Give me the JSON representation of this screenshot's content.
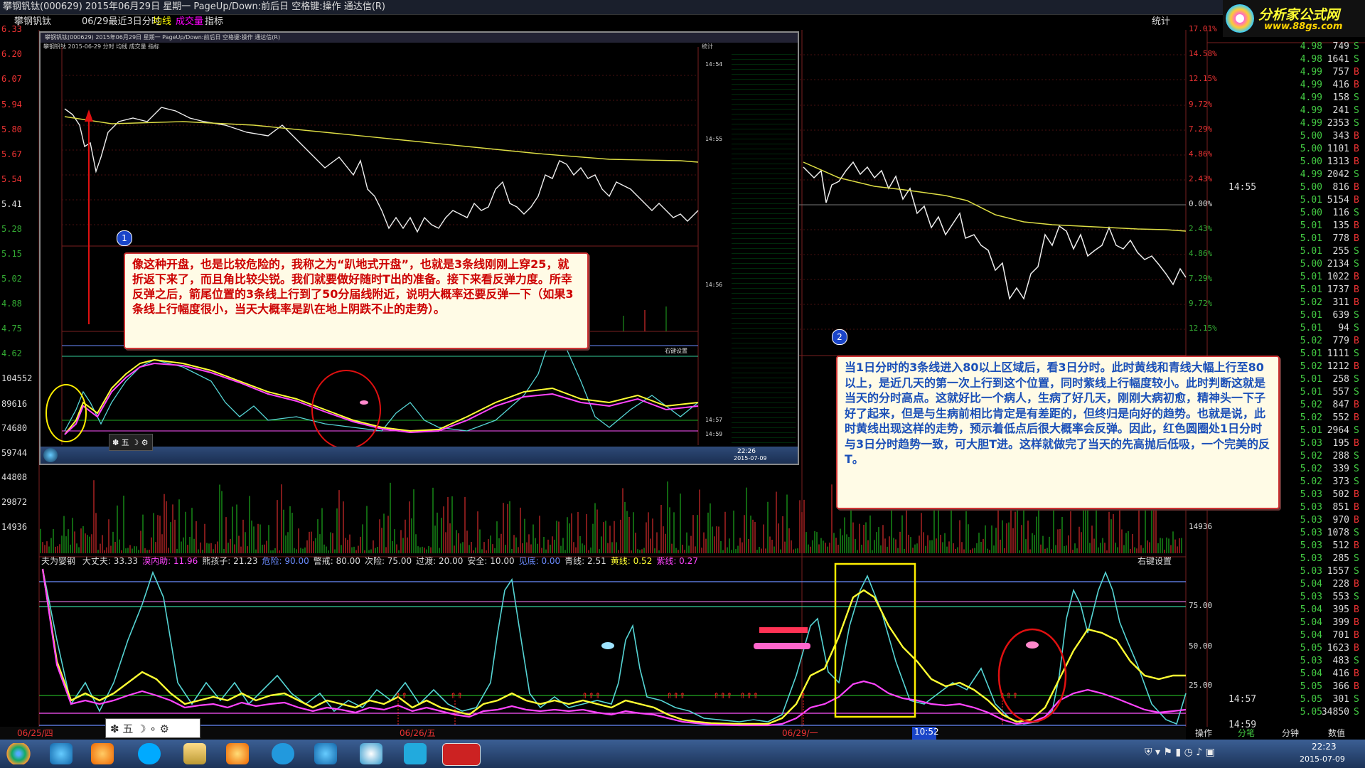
{
  "window": {
    "title": "攀钢钒钛(000629) 2015年06月29日 星期一 PageUp/Down:前后日 空格键:操作 通达信(R)"
  },
  "menubar": {
    "stock_name": "攀钢钒钛",
    "range_label": "06/29最近3日分时",
    "avg_line_label": "均线",
    "volume_label": "成交量",
    "indicator_label": "指标",
    "stats_label": "统计"
  },
  "branding": {
    "logo_text": "分析家公式网",
    "logo_url": "www.88gs.com"
  },
  "left_axis": {
    "price_ticks": [
      "6.33",
      "6.20",
      "6.07",
      "5.94",
      "5.80",
      "5.67",
      "5.54",
      "5.41",
      "5.28",
      "5.15",
      "5.02",
      "4.88",
      "4.75",
      "4.62"
    ],
    "volume_ticks": [
      "104552",
      "89616",
      "74680",
      "59744",
      "44808",
      "29872",
      "14936"
    ]
  },
  "right_axis": {
    "pct_ticks": [
      "17.01%",
      "14.58%",
      "12.15%",
      "9.72%",
      "7.29%",
      "4.86%",
      "2.43%",
      "0.00%",
      "2.43%",
      "4.86%",
      "7.29%",
      "9.72%",
      "12.15%"
    ],
    "volume_tick": "14936",
    "indicator_ticks": [
      "75.00",
      "50.00",
      "25.00"
    ]
  },
  "quote_panel": {
    "time_markers": [
      {
        "label": "14:55",
        "row": 11
      },
      {
        "label": "14:57",
        "row": 51
      },
      {
        "label": "14:59",
        "row": 53
      }
    ],
    "rows": [
      {
        "price": "4.98",
        "vol": "749",
        "bs": "S"
      },
      {
        "price": "4.98",
        "vol": "1641",
        "bs": "S"
      },
      {
        "price": "4.99",
        "vol": "757",
        "bs": "B"
      },
      {
        "price": "4.99",
        "vol": "416",
        "bs": "B"
      },
      {
        "price": "4.99",
        "vol": "158",
        "bs": "S"
      },
      {
        "price": "4.99",
        "vol": "241",
        "bs": "S"
      },
      {
        "price": "4.99",
        "vol": "2353",
        "bs": "S"
      },
      {
        "price": "5.00",
        "vol": "343",
        "bs": "B"
      },
      {
        "price": "5.00",
        "vol": "1101",
        "bs": "B"
      },
      {
        "price": "5.00",
        "vol": "1313",
        "bs": "B"
      },
      {
        "price": "4.99",
        "vol": "2042",
        "bs": "S"
      },
      {
        "price": "5.00",
        "vol": "816",
        "bs": "B"
      },
      {
        "price": "5.01",
        "vol": "5154",
        "bs": "B"
      },
      {
        "price": "5.00",
        "vol": "116",
        "bs": "S"
      },
      {
        "price": "5.01",
        "vol": "135",
        "bs": "B"
      },
      {
        "price": "5.01",
        "vol": "778",
        "bs": "B"
      },
      {
        "price": "5.01",
        "vol": "255",
        "bs": "S"
      },
      {
        "price": "5.00",
        "vol": "2134",
        "bs": "S"
      },
      {
        "price": "5.01",
        "vol": "1022",
        "bs": "B"
      },
      {
        "price": "5.01",
        "vol": "1737",
        "bs": "B"
      },
      {
        "price": "5.02",
        "vol": "311",
        "bs": "B"
      },
      {
        "price": "5.01",
        "vol": "639",
        "bs": "S"
      },
      {
        "price": "5.01",
        "vol": "94",
        "bs": "S"
      },
      {
        "price": "5.02",
        "vol": "779",
        "bs": "B"
      },
      {
        "price": "5.01",
        "vol": "1111",
        "bs": "S"
      },
      {
        "price": "5.02",
        "vol": "1212",
        "bs": "B"
      },
      {
        "price": "5.01",
        "vol": "258",
        "bs": "S"
      },
      {
        "price": "5.01",
        "vol": "557",
        "bs": "S"
      },
      {
        "price": "5.02",
        "vol": "847",
        "bs": "B"
      },
      {
        "price": "5.02",
        "vol": "552",
        "bs": "B"
      },
      {
        "price": "5.01",
        "vol": "2964",
        "bs": "S"
      },
      {
        "price": "5.03",
        "vol": "195",
        "bs": "B"
      },
      {
        "price": "5.02",
        "vol": "288",
        "bs": "S"
      },
      {
        "price": "5.02",
        "vol": "339",
        "bs": "S"
      },
      {
        "price": "5.02",
        "vol": "373",
        "bs": "S"
      },
      {
        "price": "5.03",
        "vol": "502",
        "bs": "B"
      },
      {
        "price": "5.03",
        "vol": "851",
        "bs": "B"
      },
      {
        "price": "5.03",
        "vol": "970",
        "bs": "B"
      },
      {
        "price": "5.03",
        "vol": "1078",
        "bs": "S"
      },
      {
        "price": "5.03",
        "vol": "512",
        "bs": "B"
      },
      {
        "price": "5.03",
        "vol": "285",
        "bs": "S"
      },
      {
        "price": "5.03",
        "vol": "1557",
        "bs": "S"
      },
      {
        "price": "5.04",
        "vol": "228",
        "bs": "B"
      },
      {
        "price": "5.03",
        "vol": "553",
        "bs": "S"
      },
      {
        "price": "5.04",
        "vol": "395",
        "bs": "B"
      },
      {
        "price": "5.04",
        "vol": "399",
        "bs": "B"
      },
      {
        "price": "5.04",
        "vol": "701",
        "bs": "B"
      },
      {
        "price": "5.05",
        "vol": "1623",
        "bs": "B"
      },
      {
        "price": "5.03",
        "vol": "483",
        "bs": "S"
      },
      {
        "price": "5.04",
        "vol": "416",
        "bs": "B"
      },
      {
        "price": "5.05",
        "vol": "366",
        "bs": "B"
      },
      {
        "price": "5.05",
        "vol": "301",
        "bs": "S"
      },
      {
        "price": "5.05",
        "vol": "34850",
        "bs": "S"
      }
    ]
  },
  "indicator": {
    "name": "夫为婴钢",
    "items": [
      {
        "label": "大丈夫: 33.33",
        "color": "#dddddd"
      },
      {
        "label": "漠内助: 11.96",
        "color": "#ff44ff"
      },
      {
        "label": "熊孩子: 21.23",
        "color": "#dddddd"
      },
      {
        "label": "危险: 90.00",
        "color": "#6b8cff"
      },
      {
        "label": "警戒: 80.00",
        "color": "#dddddd"
      },
      {
        "label": "次险: 75.00",
        "color": "#dddddd"
      },
      {
        "label": "过渡: 20.00",
        "color": "#dddddd"
      },
      {
        "label": "安全: 10.00",
        "color": "#dddddd"
      },
      {
        "label": "见底: 0.00",
        "color": "#6b8cff"
      },
      {
        "label": "青线: 2.51",
        "color": "#dddddd"
      },
      {
        "label": "黄线: 0.52",
        "color": "#ffff33"
      },
      {
        "label": "紫线: 0.27",
        "color": "#ff44ff"
      }
    ],
    "right_setting": "右键设置"
  },
  "bottom_bar": {
    "dates": [
      "06/25/四",
      "06/26/五",
      "06/29/一"
    ],
    "cursor_time": "10:52",
    "tabs": [
      "操作",
      "分笔",
      "分钟",
      "数值"
    ]
  },
  "notes": {
    "note1_marker": "1",
    "note1_text": "像这种开盘，也是比较危险的，我称之为“趴地式开盘”，也就是3条线刚刚上穿25，就折返下来了，而且角比较尖锐。我们就要做好随时T出的准备。接下来看反弹力度。所幸反弹之后，箭尾位置的3条线上行到了50分届线附近，说明大概率还要反弹一下（如果3条线上行幅度很小，当天大概率是趴在地上阴跌不止的走势）。",
    "note2_marker": "2",
    "note2_text": "当1日分时的3条线进入80以上区域后，看3日分时。此时黄线和青线大幅上行至80以上，是近几天的第一次上行到这个位置，同时紫线上行幅度较小。此时判断这就是当天的分时高点。这就好比一个病人，生病了好几天，刚刚大病初愈，精神头一下子好了起来，但是与生病前相比肯定是有差距的，但终归是向好的趋势。也就是说，此时黄线出现这样的走势，预示着低点后很大概率会反弹。因此，红色圆圈处1日分时与3日分时趋势一致，可大胆T进。这样就做完了当天的先高抛后低吸，一个完美的反T。"
  },
  "inset": {
    "title": "攀钢钒钛(000629) 2015年06月29日 星期一 PageUp/Down:前后日 空格键:操作 通达信(R)",
    "menu": "攀钢钒钛  2015-06-29 分时  均线  成交量  指标",
    "stats_label": "统计",
    "times": [
      "14:54",
      "14:55",
      "14:56",
      "14:57",
      "14:59"
    ],
    "indicator_setting": "右键设置",
    "clock": "22:26",
    "date": "2015-07-09"
  },
  "taskbar": {
    "time": "22:23",
    "date": "2015-07-09"
  }
}
